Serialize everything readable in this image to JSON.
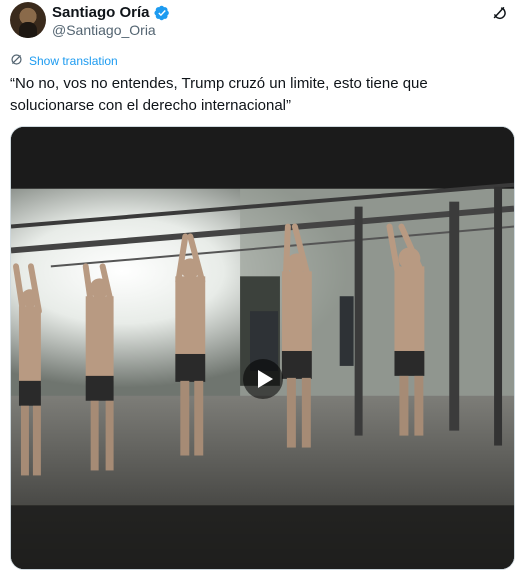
{
  "author": {
    "display_name": "Santiago Oría",
    "handle": "@Santiago_Oria",
    "verified_icon": "verified-badge-icon",
    "avatar_icon": "avatar"
  },
  "header": {
    "more_icon": "grok-icon"
  },
  "translate": {
    "label": "Show translation",
    "icon": "translate-icon"
  },
  "tweet": {
    "text": "“No no, vos no entendes, Trump cruzó un limite, esto tiene que solucionarse con el derecho internacional”"
  },
  "media": {
    "type": "video",
    "play_icon": "play-icon"
  },
  "colors": {
    "accent": "#1d9bf0",
    "text": "#0f1419",
    "secondary": "#536471"
  }
}
